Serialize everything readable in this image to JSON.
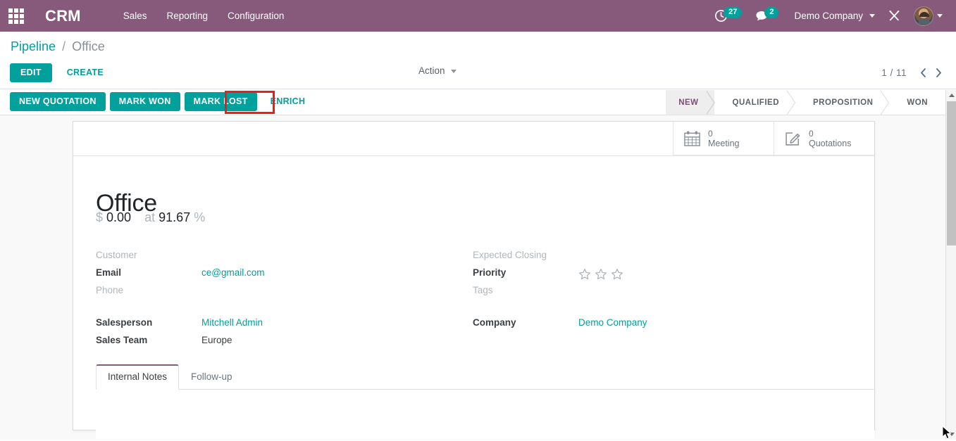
{
  "navbar": {
    "apps_icon": "apps-grid-icon",
    "brand": "CRM",
    "menus": [
      {
        "label": "Sales"
      },
      {
        "label": "Reporting"
      },
      {
        "label": "Configuration"
      }
    ],
    "activity_icon": "clock-activity-icon",
    "activity_count": "27",
    "messaging_icon": "chat-bubble-icon",
    "messaging_count": "2",
    "company": "Demo Company",
    "debug_icon": "crossed-tools-icon",
    "avatar_icon": "user-avatar",
    "accent_purple": "#875A7B",
    "accent_teal": "#00A09D"
  },
  "control_panel": {
    "breadcrumb_root": "Pipeline",
    "breadcrumb_sep": "/",
    "breadcrumb_current": "Office",
    "edit_label": "EDIT",
    "create_label": "CREATE",
    "action_label": "Action",
    "pager_text": "1 / 11",
    "prev_icon": "chevron-left-icon",
    "next_icon": "chevron-right-icon"
  },
  "statusbar": {
    "buttons": [
      {
        "label": "NEW QUOTATION",
        "style": "primary"
      },
      {
        "label": "MARK WON",
        "style": "primary"
      },
      {
        "label": "MARK LOST",
        "style": "primary"
      },
      {
        "label": "ENRICH",
        "style": "outline"
      }
    ],
    "highlight_color": "#f01c1c",
    "highlighted_button": "ENRICH",
    "stages": [
      {
        "label": "NEW",
        "active": true
      },
      {
        "label": "QUALIFIED",
        "active": false
      },
      {
        "label": "PROPOSITION",
        "active": false
      },
      {
        "label": "WON",
        "active": false
      }
    ]
  },
  "record": {
    "stat_buttons": [
      {
        "icon": "calendar-icon",
        "value": "0",
        "label": "Meeting"
      },
      {
        "icon": "pencil-square-icon",
        "value": "0",
        "label": "Quotations"
      }
    ],
    "title": "Office",
    "currency": "$",
    "amount": "0.00",
    "at_word": "at",
    "probability": "91.67",
    "percent_sign": "%",
    "fields_left": [
      {
        "label": "Customer",
        "value": "",
        "empty_label": true,
        "link": false
      },
      {
        "label": "Email",
        "value": "ce@gmail.com",
        "empty_label": false,
        "link": true
      },
      {
        "label": "Phone",
        "value": "",
        "empty_label": true,
        "link": false
      },
      {
        "label": "Salesperson",
        "value": "Mitchell Admin",
        "empty_label": false,
        "link": true
      },
      {
        "label": "Sales Team",
        "value": "Europe",
        "empty_label": false,
        "link": false
      }
    ],
    "fields_right": [
      {
        "label": "Expected Closing",
        "value": "",
        "empty_label": true,
        "link": false
      },
      {
        "label": "Priority",
        "value": "",
        "empty_label": false,
        "link": false,
        "widget": "stars"
      },
      {
        "label": "Tags",
        "value": "",
        "empty_label": true,
        "link": false
      },
      {
        "label": "Company",
        "value": "Demo Company",
        "empty_label": false,
        "link": true
      }
    ],
    "priority_stars": {
      "total": 3,
      "filled": 0
    },
    "tabs": [
      {
        "label": "Internal Notes",
        "active": true
      },
      {
        "label": "Follow-up",
        "active": false
      }
    ],
    "notes_content": ""
  }
}
